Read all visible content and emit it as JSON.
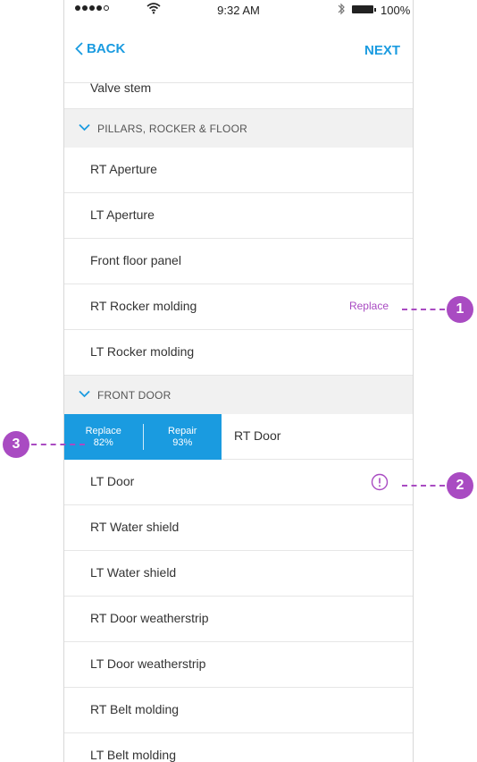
{
  "status_bar": {
    "time": "9:32 AM",
    "battery": "100%"
  },
  "nav": {
    "back_label": "BACK",
    "next_label": "NEXT"
  },
  "list": {
    "partial_top": "Valve stem",
    "section1": "PILLARS, ROCKER & FLOOR",
    "s1_items": [
      "RT Aperture",
      "LT Aperture",
      "Front floor panel",
      "RT Rocker molding",
      "LT Rocker molding"
    ],
    "rocker_action": "Replace",
    "section2": "FRONT DOOR",
    "swiped_item": "RT Door",
    "swipe_actions": [
      {
        "label": "Replace",
        "value": "82%"
      },
      {
        "label": "Repair",
        "value": "93%"
      }
    ],
    "s2_items": [
      "LT Door",
      "RT Water shield",
      "LT Water shield",
      "RT Door weatherstrip",
      "LT Door weatherstrip",
      "RT Belt molding",
      "LT Belt molding"
    ]
  },
  "callouts": [
    "1",
    "2",
    "3"
  ],
  "colors": {
    "accent": "#1a9be0",
    "annotation": "#a94bc2",
    "section_bg": "#f1f1f1"
  }
}
